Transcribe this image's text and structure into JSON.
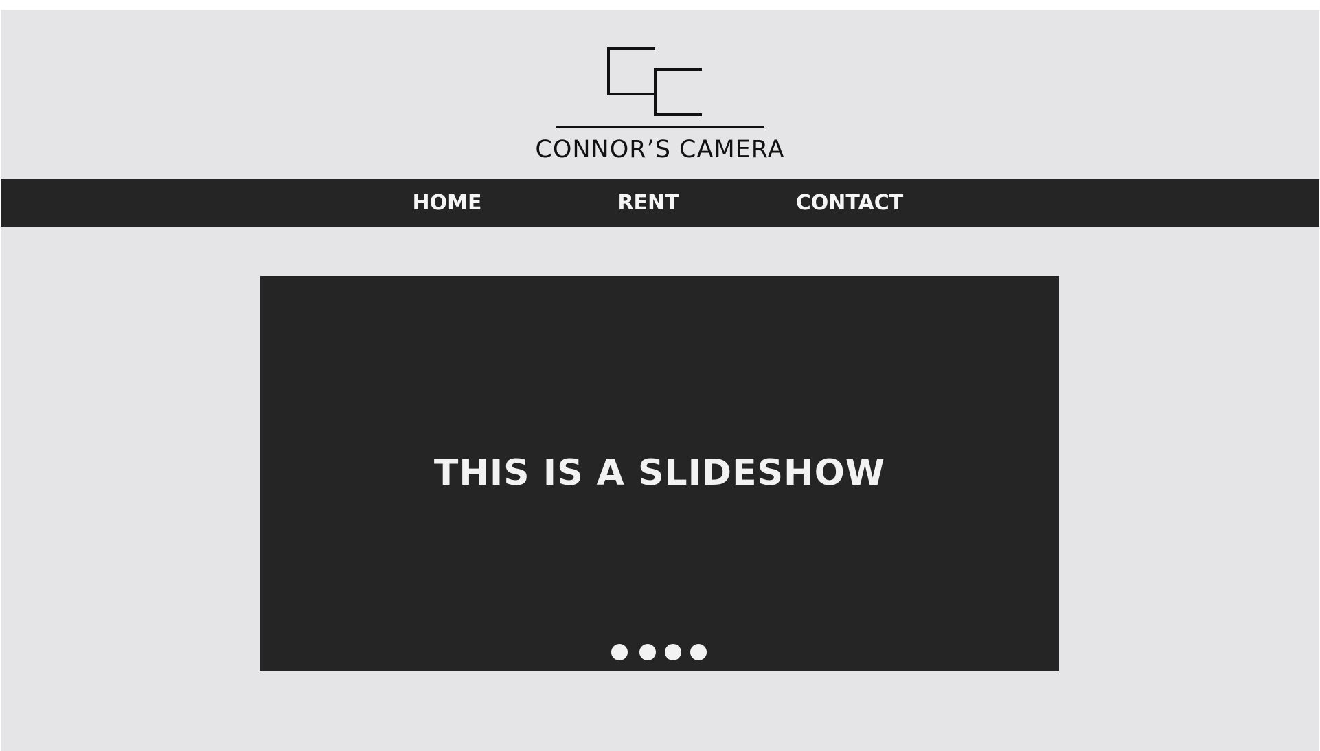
{
  "brand": {
    "name": "CONNOR’S CAMERA",
    "logo_icon": "cc-monogram-icon"
  },
  "nav": {
    "items": [
      {
        "label": "HOME"
      },
      {
        "label": "RENT"
      },
      {
        "label": "CONTACT"
      }
    ]
  },
  "slideshow": {
    "caption": "THIS IS A SLIDESHOW",
    "slide_count": 4
  },
  "colors": {
    "background": "#e5e5e7",
    "dark": "#262526",
    "light_text": "#f2f2f2"
  }
}
